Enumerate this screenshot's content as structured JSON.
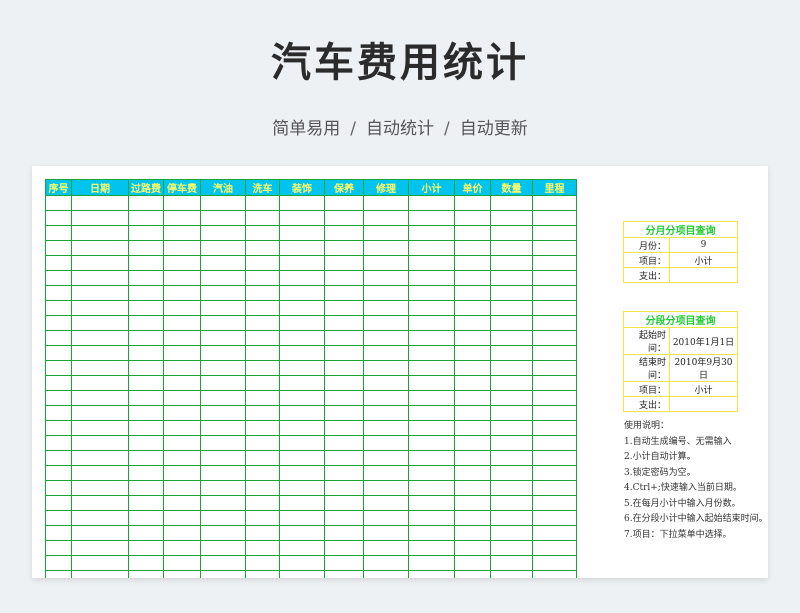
{
  "header": {
    "title": "汽车费用统计",
    "subtitle_parts": [
      "简单易用",
      "自动统计",
      "自动更新"
    ],
    "separator": "/"
  },
  "table": {
    "columns": [
      "序号",
      "日期",
      "过路费",
      "停车费",
      "汽油",
      "洗车",
      "装饰",
      "保养",
      "修理",
      "小计",
      "单价",
      "数量",
      "里程"
    ],
    "row_count": 26
  },
  "monthly_query": {
    "title": "分月分项目查询",
    "rows": [
      {
        "label": "月份：",
        "value": "9"
      },
      {
        "label": "项目：",
        "value": "小计"
      },
      {
        "label": "支出：",
        "value": ""
      }
    ]
  },
  "period_query": {
    "title": "分段分项目查询",
    "rows": [
      {
        "label": "起始时间：",
        "value": "2010年1月1日"
      },
      {
        "label": "结束时间：",
        "value": "2010年9月30日"
      },
      {
        "label": "项目：",
        "value": "小计"
      },
      {
        "label": "支出：",
        "value": ""
      }
    ]
  },
  "instructions": {
    "title": "使用说明：",
    "items": [
      "1.自动生成编号、无需输入",
      "2.小计自动计算。",
      "3.锁定密码为空。",
      "4.Ctrl+;快速输入当前日期。",
      "5.在每月小计中输入月份数。",
      "6.在分段小计中输入起始结束时间。",
      "7.项目：下拉菜单中选择。"
    ]
  },
  "colors": {
    "header_bg": "#00c4ee",
    "header_text": "#ffff66",
    "grid_border": "#1aa53a",
    "panel_border": "#f0e840",
    "panel_title": "#22cc33"
  }
}
